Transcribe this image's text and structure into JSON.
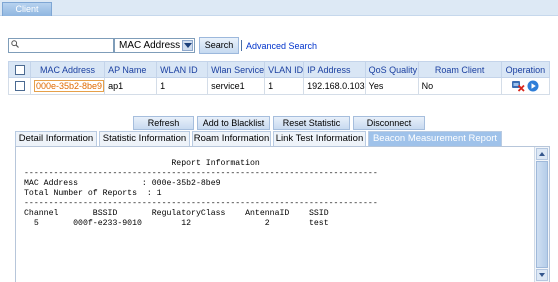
{
  "top_tab": {
    "label": "Client"
  },
  "search": {
    "placeholder": "",
    "field_value": "MAC Address",
    "search_label": "Search",
    "advanced_label": "Advanced Search"
  },
  "table": {
    "headers": [
      "MAC Address",
      "AP Name",
      "WLAN ID",
      "Wlan Service",
      "VLAN ID",
      "IP Address",
      "QoS Quality",
      "Roam Client",
      "Operation"
    ],
    "rows": [
      {
        "mac": "000e-35b2-8be9",
        "ap": "ap1",
        "wlan_id": "1",
        "service": "service1",
        "vlan_id": "1",
        "ip": "192.168.0.103",
        "qos": "Yes",
        "roam": "No"
      }
    ]
  },
  "actions": {
    "refresh": "Refresh",
    "blacklist": "Add to Blacklist",
    "reset": "Reset Statistic",
    "disconnect": "Disconnect"
  },
  "subtabs": [
    "Detail Information",
    "Statistic Information",
    "Roam Information",
    "Link Test Information",
    "Beacon Measurement Report"
  ],
  "report": {
    "text": "                              Report Information\n------------------------------------------------------------------------\nMAC Address             : 000e-35b2-8be9\nTotal Number of Reports  : 1\n------------------------------------------------------------------------\nChannel       BSSID       RegulatoryClass    AntennaID    SSID\n  5       000f-e233-9010        12               2        test"
  }
}
